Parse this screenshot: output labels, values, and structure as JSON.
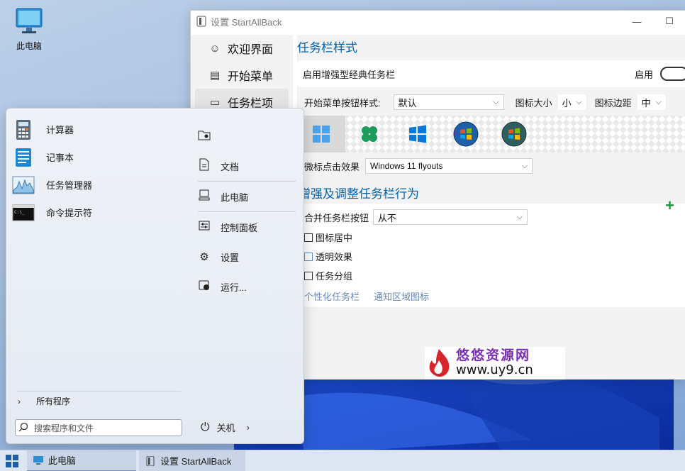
{
  "desktop": {
    "icon_label": "此电脑"
  },
  "settings": {
    "window_title": "设置 StartAllBack",
    "controls": {
      "minimize": "—",
      "maximize": "☐"
    },
    "nav": [
      {
        "label": "欢迎界面",
        "icon": "smile-icon"
      },
      {
        "label": "开始菜单",
        "icon": "start-menu-icon"
      },
      {
        "label": "任务栏项",
        "icon": "taskbar-icon"
      }
    ],
    "section1_title": "任务栏样式",
    "enable_label": "启用增强型经典任务栏",
    "enable_state": "启用",
    "start_btn_style_label": "开始菜单按钮样式:",
    "start_btn_style_value": "默认",
    "icon_size_label": "图标大小",
    "icon_size_value": "小",
    "icon_margin_label": "图标边距",
    "icon_margin_value": "中",
    "start_button_styles": [
      "windows11",
      "clover",
      "windows10",
      "windows7",
      "windows-vista"
    ],
    "click_effect_label": "微标点击效果",
    "click_effect_value": "Windows 11 flyouts",
    "section2_title": "增强及调整任务栏行为",
    "combine_label": "合并任务栏按钮",
    "combine_value": "从不",
    "checkboxes": [
      {
        "label": "图标居中",
        "checked": false
      },
      {
        "label": "透明效果",
        "checked": false
      },
      {
        "label": "任务分组",
        "checked": false
      }
    ],
    "links": [
      "个性化任务栏",
      "通知区域图标"
    ],
    "accent_color": "#0063b1"
  },
  "watermark": {
    "title": "悠悠资源网",
    "url": "www.uy9.cn"
  },
  "start_menu": {
    "apps": [
      {
        "label": "计算器",
        "icon": "calculator-icon"
      },
      {
        "label": "记事本",
        "icon": "notepad-icon"
      },
      {
        "label": "任务管理器",
        "icon": "task-manager-icon"
      },
      {
        "label": "命令提示符",
        "icon": "command-prompt-icon"
      }
    ],
    "places": [
      {
        "label": "",
        "icon": "user-folder-icon"
      },
      {
        "label": "文档",
        "icon": "document-icon"
      },
      {
        "label": "此电脑",
        "icon": "computer-icon"
      },
      {
        "label": "控制面板",
        "icon": "control-panel-icon"
      },
      {
        "label": "设置",
        "icon": "gear-icon"
      },
      {
        "label": "运行...",
        "icon": "run-icon"
      }
    ],
    "all_programs": "所有程序",
    "search_placeholder": "搜索程序和文件",
    "shutdown_label": "关机"
  },
  "taskbar": {
    "items": [
      {
        "label": "此电脑",
        "icon": "computer-icon"
      },
      {
        "label": "设置 StartAllBack",
        "icon": "settings-app-icon"
      }
    ]
  }
}
